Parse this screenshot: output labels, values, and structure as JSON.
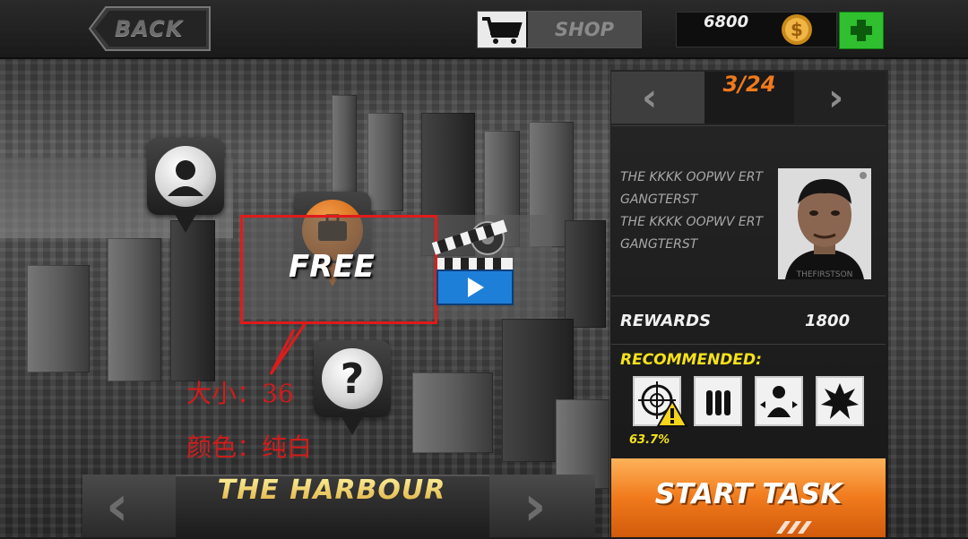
{
  "header": {
    "back_label": "BACK",
    "shop_label": "SHOP",
    "coins": "6800"
  },
  "map": {
    "free_label": "FREE",
    "annotation_lines": [
      "大小：36",
      "颜色：纯白"
    ]
  },
  "level_selector": {
    "name": "THE HARBOUR"
  },
  "mission": {
    "page": "3/24",
    "target_lines": [
      "THE KKKK  OOPWV ERT",
      "GANGTERST",
      "THE KKKK  OOPWV ERT",
      "GANGTERST"
    ],
    "photo_watermark": "THEFIRSTSON",
    "rewards_label": "REWARDS",
    "rewards_value": "1800",
    "recommended_label": "RECOMMENDED:",
    "recommended_items": [
      {
        "icon": "sniper-scope-icon",
        "warning": true
      },
      {
        "icon": "ammo-icon",
        "warning": false
      },
      {
        "icon": "target-person-icon",
        "warning": false
      },
      {
        "icon": "explosion-icon",
        "warning": false
      }
    ],
    "hit_chance": "63.7%",
    "start_label": "START TASK"
  },
  "colors": {
    "accent_orange": "#f07a1c",
    "recommended_yellow": "#f5e21a",
    "add_green": "#2fbf2f",
    "annotation_red": "#e01b1b"
  }
}
